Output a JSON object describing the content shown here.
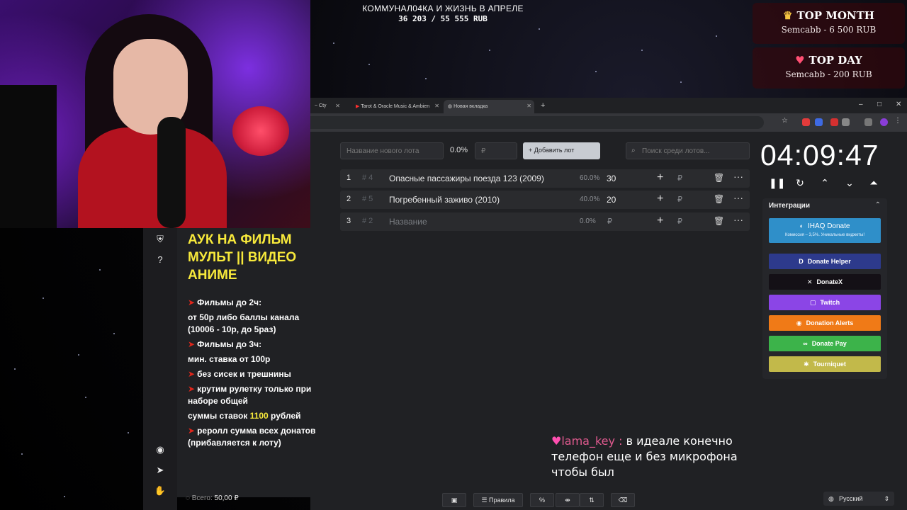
{
  "overlay": {
    "goal_title": "КОММУНАЛ04КА И ЖИЗНЬ В АПРЕЛЕ",
    "goal_progress": "36 203 / 55 555 RUB",
    "top_month": {
      "label": "TOP MONTH",
      "value": "Semcabb - 6 500 RUB"
    },
    "top_day": {
      "label": "TOP DAY",
      "value": "Semcabb - 200 RUB"
    }
  },
  "browser": {
    "tabs": [
      {
        "label": "~ Cty",
        "icons": "speaker, close"
      },
      {
        "label": "Tarot & Oracle Music & Ambien"
      },
      {
        "label": "Новая вкладка"
      }
    ],
    "new_tab": "+",
    "window_controls": [
      "–",
      "□",
      "✕"
    ]
  },
  "sidebar": {
    "icons": [
      "shield-icon",
      "help-icon",
      "github-icon",
      "telegram-icon",
      "donate-hand-icon"
    ]
  },
  "rules": {
    "title": "АУК НА ФИЛЬМ МУЛЬТ || ВИДЕО АНИМЕ",
    "lines": [
      {
        "arrow": true,
        "text": "Фильмы до 2ч:"
      },
      {
        "arrow": false,
        "text": "от 50р либо баллы канала (10006 - 10р, до 5раз)"
      },
      {
        "arrow": true,
        "text": "Фильмы до 3ч:"
      },
      {
        "arrow": false,
        "text": "мин. ставка от 100р"
      },
      {
        "arrow": true,
        "text": "без сисек и трешнины"
      },
      {
        "arrow": true,
        "text": "крутим рулетку только при наборе общей"
      },
      {
        "arrow": false,
        "text_before": "суммы ставок ",
        "highlight": "1100",
        "text_after": " рублей"
      },
      {
        "arrow": true,
        "text": "реролл сумма всех донатов (прибавляется к лоту)"
      }
    ]
  },
  "total": {
    "label": "Всего:",
    "value": "50,00 ₽"
  },
  "lot_form": {
    "name_placeholder": "Название нового лота",
    "percent": "0.0%",
    "amount_placeholder": "₽",
    "add_button": "Добавить лот",
    "search_placeholder": "Поиск среди лотов..."
  },
  "lots": [
    {
      "num": "1",
      "id": "# 4",
      "name": "Опасные пассажиры поезда 123 (2009)",
      "percent": "60.0%",
      "amount": "30",
      "rub": "₽"
    },
    {
      "num": "2",
      "id": "# 5",
      "name": "Погребенный заживо (2010)",
      "percent": "40.0%",
      "amount": "20",
      "rub": "₽"
    },
    {
      "num": "3",
      "id": "# 2",
      "name": "Название",
      "percent": "0.0%",
      "amount": "",
      "rub": "₽"
    }
  ],
  "timer": {
    "value": "04:09:47"
  },
  "integrations": {
    "title": "Интеграции",
    "ihaq": {
      "label": "IHAQ Donate",
      "sub": "Комиссия – 3,5%. Уникальные виджеты!"
    },
    "buttons": [
      {
        "label": "Donate Helper",
        "color": "#2d3a8c",
        "icon": "D"
      },
      {
        "label": "DonateX",
        "color": "#141016",
        "icon": "✕"
      },
      {
        "label": "Twitch",
        "color": "#8b45e6",
        "icon": "▢"
      },
      {
        "label": "Donation Alerts",
        "color": "#f07a17",
        "icon": "◉"
      },
      {
        "label": "Donate Pay",
        "color": "#3cb34a",
        "icon": "∞"
      },
      {
        "label": "Tourniquet",
        "color": "#c2b94a",
        "icon": "✱"
      }
    ]
  },
  "chat": {
    "user": "lama_key",
    "sep": " : ",
    "message": "в идеале конечно телефон еще и без микрофона чтобы был"
  },
  "toolbar": {
    "rules_label": "Правила",
    "percent_label": "%"
  },
  "language": {
    "label": "Русский"
  }
}
